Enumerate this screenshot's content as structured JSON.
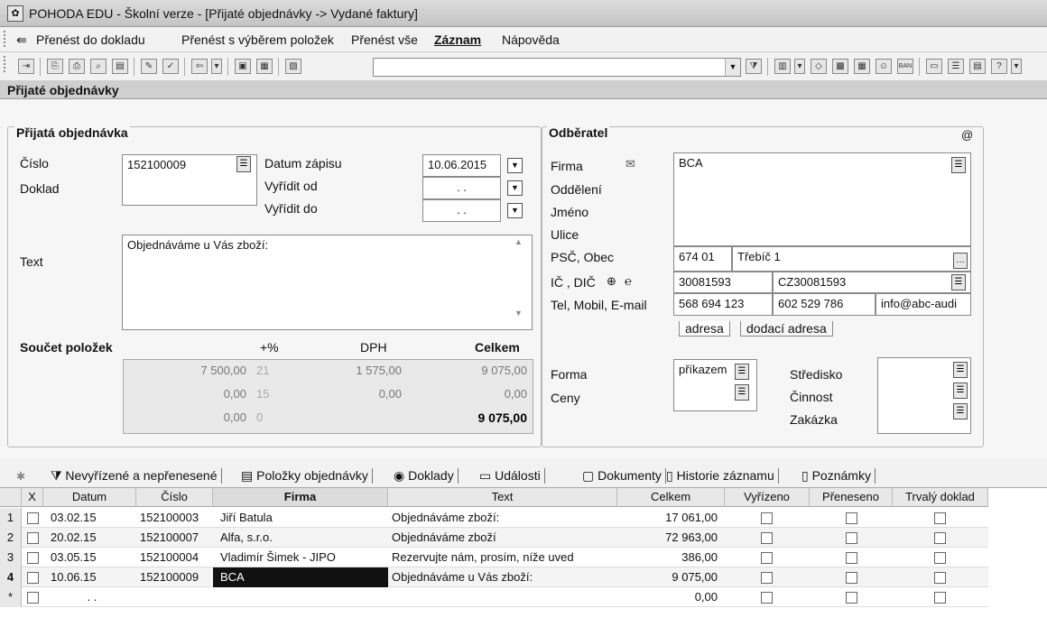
{
  "window": {
    "title": "POHODA EDU - Školní verze - [Přijaté objednávky -> Vydané faktury]"
  },
  "menu": [
    "Přenést do dokladu",
    "Přenést s výběrem položek",
    "Přenést vše",
    "Záznam",
    "Nápověda"
  ],
  "section": {
    "title": "Přijaté objednávky"
  },
  "order": {
    "group_title": "Přijatá objednávka",
    "cislo_label": "Číslo",
    "cislo_value": "152100009",
    "doklad_label": "Doklad",
    "datum_zapisu_label": "Datum zápisu",
    "datum_zapisu_value": "10.06.2015",
    "vyridit_od_label": "Vyřídit od",
    "vyridit_od_value": ". .",
    "vyridit_do_label": "Vyřídit do",
    "vyridit_do_value": ". .",
    "text_label": "Text",
    "text_value": "Objednáváme u Vás zboží:"
  },
  "summary": {
    "title": "Součet položek",
    "col_pct": "+%",
    "col_dph": "DPH",
    "col_total": "Celkem",
    "rows": [
      {
        "base": "7 500,00",
        "pct": "21",
        "dph": "1 575,00",
        "total": "9 075,00"
      },
      {
        "base": "0,00",
        "pct": "15",
        "dph": "0,00",
        "total": "0,00"
      },
      {
        "base": "0,00",
        "pct": "0",
        "dph": "",
        "total": "9 075,00"
      }
    ]
  },
  "customer": {
    "group_title": "Odběratel",
    "at": "@",
    "firma_label": "Firma",
    "firma_value": "BCA",
    "oddeleni_label": "Oddělení",
    "jmeno_label": "Jméno",
    "ulice_label": "Ulice",
    "psc_label": "PSČ, Obec",
    "psc_value": "674 01",
    "obec_value": "Třebíč 1",
    "ic_label": "IČ , DIČ",
    "ic_value": "30081593",
    "dic_value": "CZ30081593",
    "tel_label": "Tel, Mobil, E-mail",
    "tel_value": "568 694 123",
    "mobil_value": "602 529 786",
    "email_value": "info@abc-audi",
    "tab_adresa": "adresa",
    "tab_dodaci": "dodací adresa",
    "forma_label": "Forma",
    "forma_value": "příkazem",
    "ceny_label": "Ceny",
    "stredisko_label": "Středisko",
    "cinnost_label": "Činnost",
    "zakazka_label": "Zakázka"
  },
  "tabs": [
    "Nevyřízené a nepřenesené",
    "Položky objednávky",
    "Doklady",
    "Události",
    "Dokumenty",
    "Historie záznamu",
    "Poznámky"
  ],
  "grid": {
    "headers": [
      "X",
      "Datum",
      "Číslo",
      "Firma",
      "Text",
      "Celkem",
      "Vyřízeno",
      "Přeneseno",
      "Trvalý doklad"
    ],
    "rows": [
      {
        "n": "1",
        "datum": "03.02.15",
        "cislo": "152100003",
        "firma": "Jiří Batula",
        "text": "Objednáváme zboží:",
        "celkem": "17 061,00"
      },
      {
        "n": "2",
        "datum": "20.02.15",
        "cislo": "152100007",
        "firma": "Alfa, s.r.o.",
        "text": "Objednáváme zboží",
        "celkem": "72 963,00"
      },
      {
        "n": "3",
        "datum": "03.05.15",
        "cislo": "152100004",
        "firma": "Vladimír Šimek - JIPO",
        "text": "Rezervujte nám, prosím, níže uved",
        "celkem": "386,00"
      },
      {
        "n": "4",
        "datum": "10.06.15",
        "cislo": "152100009",
        "firma": "BCA",
        "text": "Objednáváme u Vás zboží:",
        "celkem": "9 075,00"
      },
      {
        "n": "*",
        "datum": ". .",
        "cislo": "",
        "firma": "",
        "text": "",
        "celkem": "0,00"
      }
    ]
  }
}
